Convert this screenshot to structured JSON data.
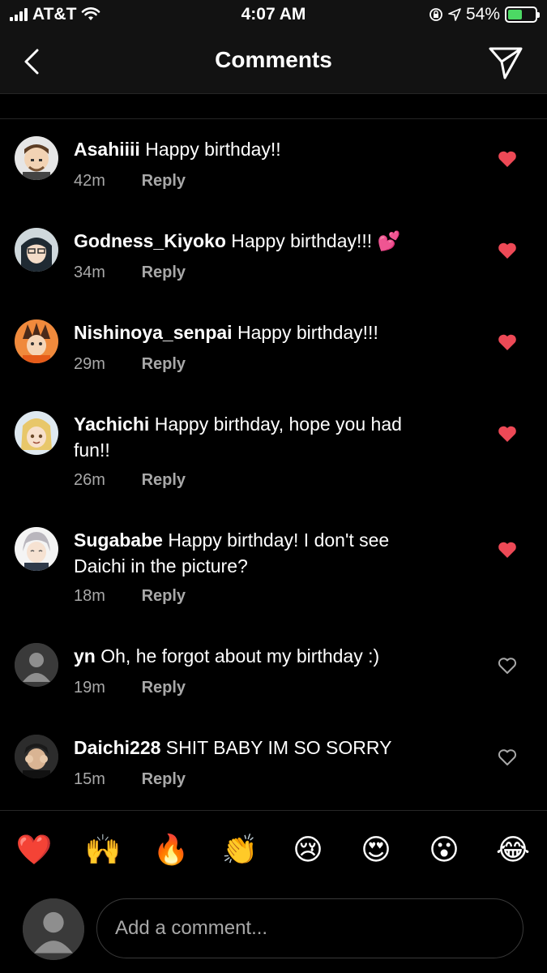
{
  "status": {
    "carrier": "AT&T",
    "time": "4:07 AM",
    "battery": "54%",
    "battery_level": 0.54
  },
  "header": {
    "title": "Comments"
  },
  "comments": [
    {
      "username": "Asahiiii",
      "text": "Happy birthday!!",
      "time": "42m",
      "reply": "Reply",
      "liked": true,
      "avatar": "asahi-avatar"
    },
    {
      "username": "Godness_Kiyoko",
      "text": "Happy birthday!!! 💕",
      "time": "34m",
      "reply": "Reply",
      "liked": true,
      "avatar": "kiyoko-avatar"
    },
    {
      "username": "Nishinoya_senpai",
      "text": "Happy birthday!!!",
      "time": "29m",
      "reply": "Reply",
      "liked": true,
      "avatar": "nishinoya-avatar"
    },
    {
      "username": "Yachichi",
      "text": "Happy birthday, hope you had fun!!",
      "time": "26m",
      "reply": "Reply",
      "liked": true,
      "avatar": "yachi-avatar"
    },
    {
      "username": "Sugababe",
      "text": "Happy birthday! I don't see Daichi in the picture?",
      "time": "18m",
      "reply": "Reply",
      "liked": true,
      "avatar": "suga-avatar"
    },
    {
      "username": "yn",
      "text": "Oh, he forgot about my birthday :)",
      "time": "19m",
      "reply": "Reply",
      "liked": false,
      "avatar": "default-avatar"
    },
    {
      "username": "Daichi228",
      "text": "SHIT BABY IM SO SORRY",
      "time": "15m",
      "reply": "Reply",
      "liked": false,
      "avatar": "daichi-avatar"
    }
  ],
  "emoji_bar": [
    "❤️",
    "🙌",
    "🔥",
    "👏",
    "😢",
    "😍",
    "😮",
    "😂"
  ],
  "compose": {
    "placeholder": "Add a comment..."
  },
  "colors": {
    "like_red": "#ed4956",
    "muted": "#a8a8a8",
    "background": "#000000",
    "bar": "#121212"
  }
}
